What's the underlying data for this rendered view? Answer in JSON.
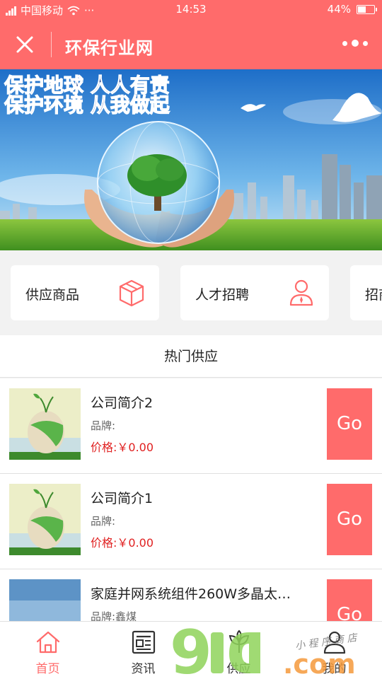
{
  "status_bar": {
    "carrier": "中国移动",
    "dots": "···",
    "time": "14:53",
    "battery": "44%",
    "battery_level": 0.44
  },
  "nav": {
    "title": "环保行业网"
  },
  "banner": {
    "line1": "保护地球  人人有责",
    "line2": "保护环境  从我做起"
  },
  "categories": [
    {
      "label": "供应商品",
      "icon": "box-icon"
    },
    {
      "label": "人才招聘",
      "icon": "person-icon"
    },
    {
      "label": "招商",
      "icon": ""
    }
  ],
  "section": {
    "title": "热门供应"
  },
  "products": [
    {
      "name": "公司简介2",
      "brand": "品牌:",
      "price": "价格:￥0.00",
      "button": "Go"
    },
    {
      "name": "公司简介1",
      "brand": "品牌:",
      "price": "价格:￥0.00",
      "button": "Go"
    },
    {
      "name": "家庭并网系统组件260W多晶太…",
      "brand": "品牌:鑫煤",
      "price": "",
      "button": "Go"
    }
  ],
  "tabs": [
    {
      "label": "首页",
      "icon": "home-icon",
      "active": true
    },
    {
      "label": "资讯",
      "icon": "news-icon",
      "active": false
    },
    {
      "label": "供应",
      "icon": "leaf-icon",
      "active": false
    },
    {
      "label": "我的",
      "icon": "profile-icon",
      "active": false
    }
  ],
  "watermark": {
    "text_main": "9",
    "text_tail": ".com",
    "text_small": "小 程 序 商 店"
  },
  "colors": {
    "accent": "#ff6b6b",
    "price": "#e02020"
  }
}
